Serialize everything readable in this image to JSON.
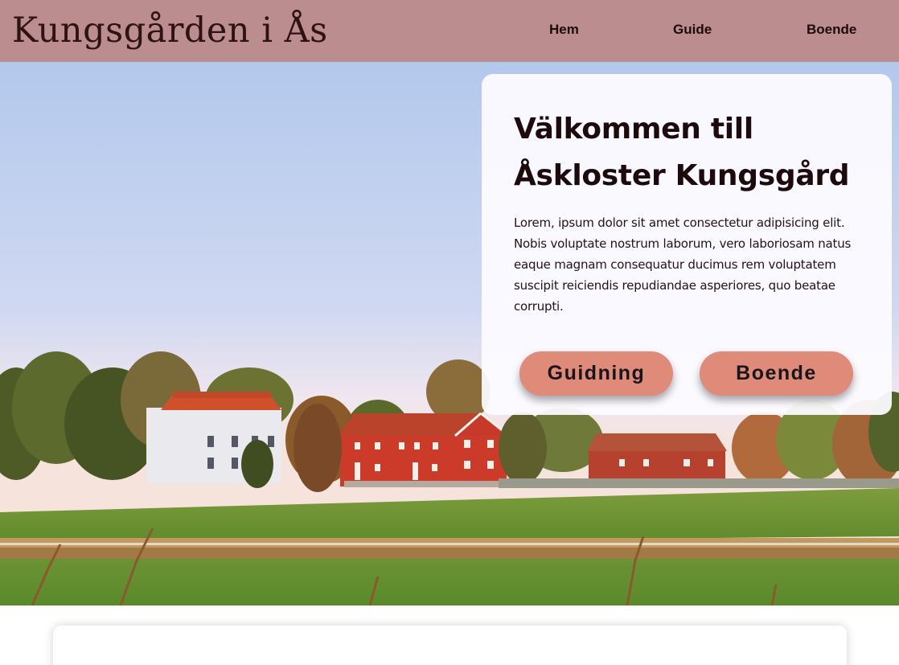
{
  "header": {
    "brand": "Kungsgården i Ås",
    "nav": {
      "home": "Hem",
      "guide": "Guide",
      "stay": "Boende"
    }
  },
  "hero": {
    "title": "Välkommen till Åskloster Kungsgård",
    "body": "Lorem, ipsum dolor sit amet consectetur adipisicing elit. Nobis voluptate nostrum laborum, vero laboriosam natus eaque magnam consequatur ducimus rem voluptatem suscipit reiciendis repudiandae asperiores, quo beatae corrupti.",
    "buttons": {
      "guiding": "Guidning",
      "stay": "Boende"
    }
  },
  "colors": {
    "navbar": "#bb8d8e",
    "button": "#e08a7a",
    "heading": "#1d0a0c"
  }
}
